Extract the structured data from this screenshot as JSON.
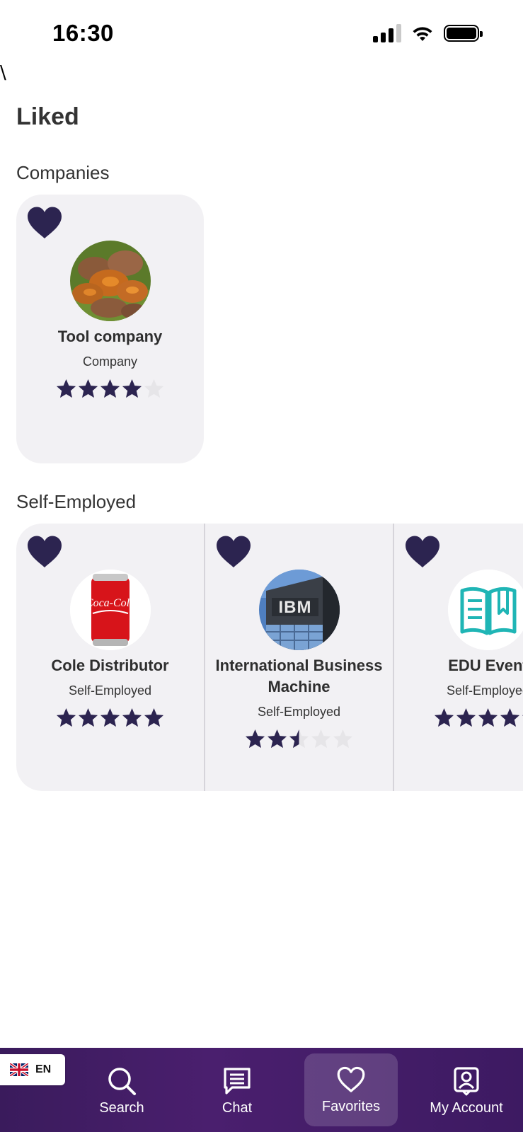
{
  "status_bar": {
    "time": "16:30"
  },
  "stray_text": "\\",
  "page_title": "Liked",
  "sections": {
    "companies": {
      "title": "Companies",
      "cards": [
        {
          "name": "Tool company",
          "type": "Company",
          "rating": 4,
          "image": "mushroom-photo"
        }
      ]
    },
    "self_employed": {
      "title": "Self-Employed",
      "cards": [
        {
          "name": "Cole Distributor",
          "type": "Self-Employed",
          "rating": 5,
          "image": "soda-can-photo"
        },
        {
          "name": "International Business Machine",
          "type": "Self-Employed",
          "rating": 2.5,
          "image": "ibm-building-photo"
        },
        {
          "name": "EDU Event",
          "type": "Self-Employed",
          "rating": 5,
          "image": "book-icon"
        }
      ]
    }
  },
  "bottom_nav": {
    "items": [
      {
        "label": "Search",
        "icon": "search-icon"
      },
      {
        "label": "Chat",
        "icon": "chat-icon"
      },
      {
        "label": "Favorites",
        "icon": "heart-icon",
        "active": true
      },
      {
        "label": "My Account",
        "icon": "account-icon"
      }
    ]
  },
  "language": {
    "code": "EN",
    "flag": "uk-flag-icon"
  },
  "colors": {
    "accent": "#2c2450",
    "card_bg": "#f2f1f4",
    "nav_bg": "#43206a",
    "star_empty": "#e6e5e8"
  }
}
